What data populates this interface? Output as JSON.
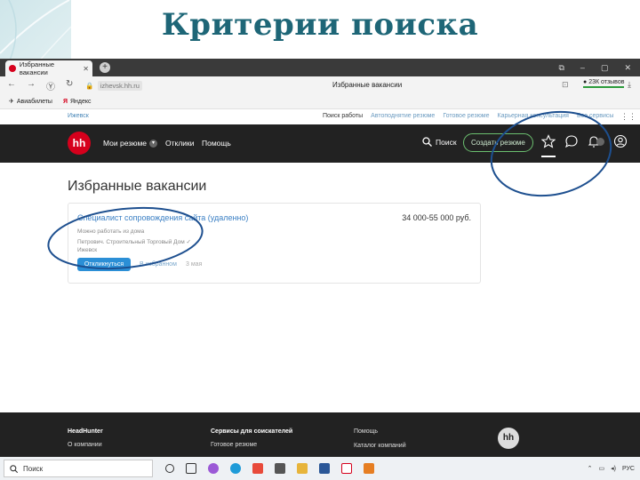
{
  "slide": {
    "title": "Критерии поиска"
  },
  "browser": {
    "tab_title": "Избранные вакансии",
    "url_host": "izhevsk.hh.ru",
    "page_title": "Избранные вакансии",
    "reviews_badge": "23К отзывов",
    "bookmarks": [
      "Авиабилеты",
      "Яндекс"
    ]
  },
  "hh": {
    "city": "Ижевск",
    "top_links": [
      "Поиск работы",
      "Автоподнятие резюме",
      "Готовое резюме",
      "Карьерная консультация",
      "Все сервисы"
    ],
    "logo": "hh",
    "nav": {
      "my_resumes": "Мои резюме",
      "responses": "Отклики",
      "help": "Помощь",
      "search": "Поиск",
      "create_resume": "Создать резюме"
    },
    "page_heading": "Избранные вакансии",
    "vacancy": {
      "title": "Специалист сопровождения сайта (удаленно)",
      "salary": "34 000-55 000 руб.",
      "remote": "Можно работать из дома",
      "company": "Петрович. Строительный Торговый Дом",
      "city": "Ижевск",
      "respond": "Откликнуться",
      "favorite": "В избранном",
      "date": "3 мая"
    },
    "footer": {
      "col1_title": "HeadHunter",
      "col1_item": "О компании",
      "col2_title": "Сервисы для соискателей",
      "col2_item": "Готовое резюме",
      "col3_title": "Помощь",
      "col3_item": "Каталог компаний",
      "logo": "hh"
    }
  },
  "taskbar": {
    "search_placeholder": "Поиск",
    "lang": "РУС"
  },
  "colors": {
    "title": "#1e6677",
    "hh_red": "#d6001c",
    "link": "#3a7fc4",
    "ellipse": "#1d4f8f",
    "create_border": "#6bbf6f"
  }
}
